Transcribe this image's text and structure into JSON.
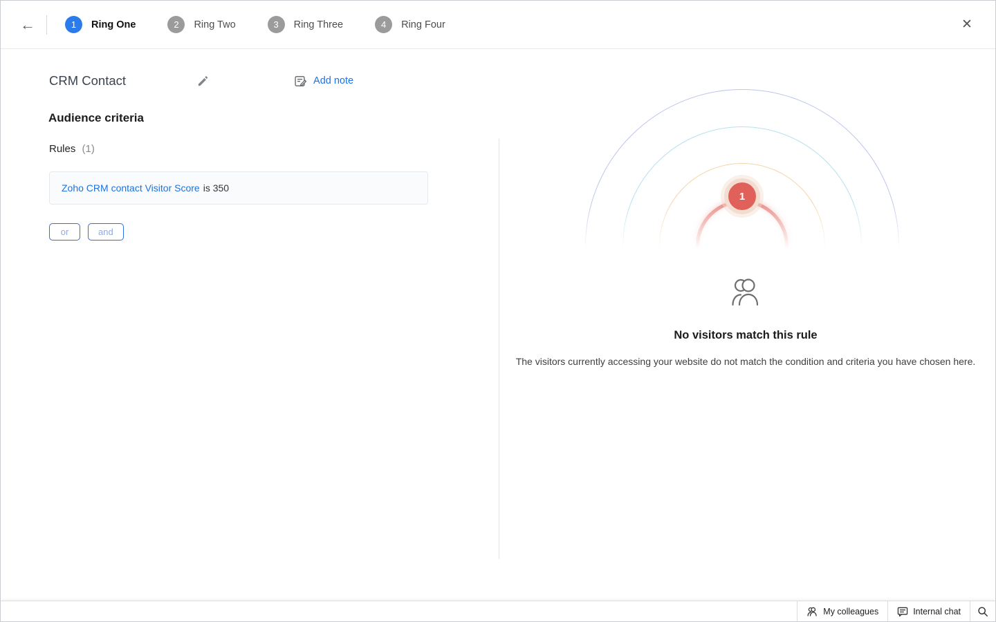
{
  "header": {
    "back_icon": "←",
    "close_icon": "✕",
    "steps": [
      {
        "number": "1",
        "label": "Ring One",
        "active": true
      },
      {
        "number": "2",
        "label": "Ring Two",
        "active": false
      },
      {
        "number": "3",
        "label": "Ring Three",
        "active": false
      },
      {
        "number": "4",
        "label": "Ring Four",
        "active": false
      }
    ]
  },
  "main": {
    "title": "CRM Contact",
    "add_note_label": "Add note",
    "section_heading": "Audience criteria",
    "rules_label": "Rules",
    "rules_count": "(1)",
    "rule": {
      "field": "Zoho CRM contact Visitor Score",
      "condition": "is 350"
    },
    "or_button": "or",
    "and_button": "and"
  },
  "preview": {
    "badge_count": "1",
    "empty_title": "No visitors match this rule",
    "empty_description": "The visitors currently accessing your website do not match the condition and criteria you have chosen here."
  },
  "footer": {
    "my_colleagues_label": "My colleagues",
    "internal_chat_label": "Internal chat"
  },
  "colors": {
    "accent_blue": "#1a73e8",
    "step_active_blue": "#2b7bea",
    "step_inactive_gray": "#9b9b9b",
    "badge_red": "#e06159",
    "ring_red": "#e16e66",
    "ring_orange": "#f3d6a9",
    "ring_cyan": "#b7e0ef",
    "ring_blue": "#bcc5ec",
    "rule_card_bg": "#f9fbfd"
  }
}
